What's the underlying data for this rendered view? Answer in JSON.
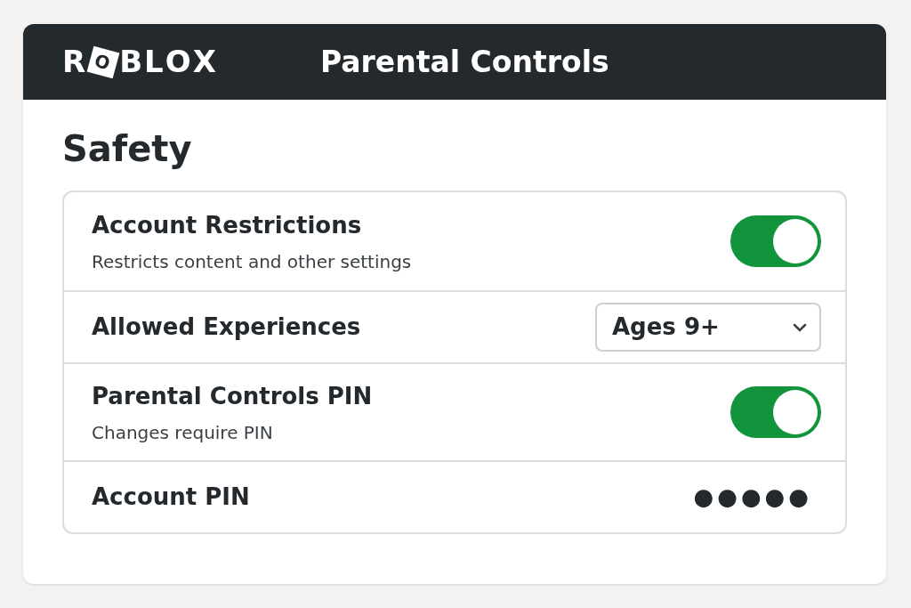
{
  "header": {
    "logo": "ROBLOX",
    "title": "Parental Controls"
  },
  "section": {
    "title": "Safety"
  },
  "settings": [
    {
      "kind": "toggle",
      "label": "Account Restrictions",
      "description": "Restricts content and other settings",
      "on": true
    },
    {
      "kind": "select",
      "label": "Allowed Experiences",
      "value": "Ages 9+"
    },
    {
      "kind": "toggle",
      "label": "Parental Controls PIN",
      "description": "Changes require PIN",
      "on": true
    },
    {
      "kind": "pin",
      "label": "Account PIN",
      "value": "●●●●●"
    }
  ]
}
